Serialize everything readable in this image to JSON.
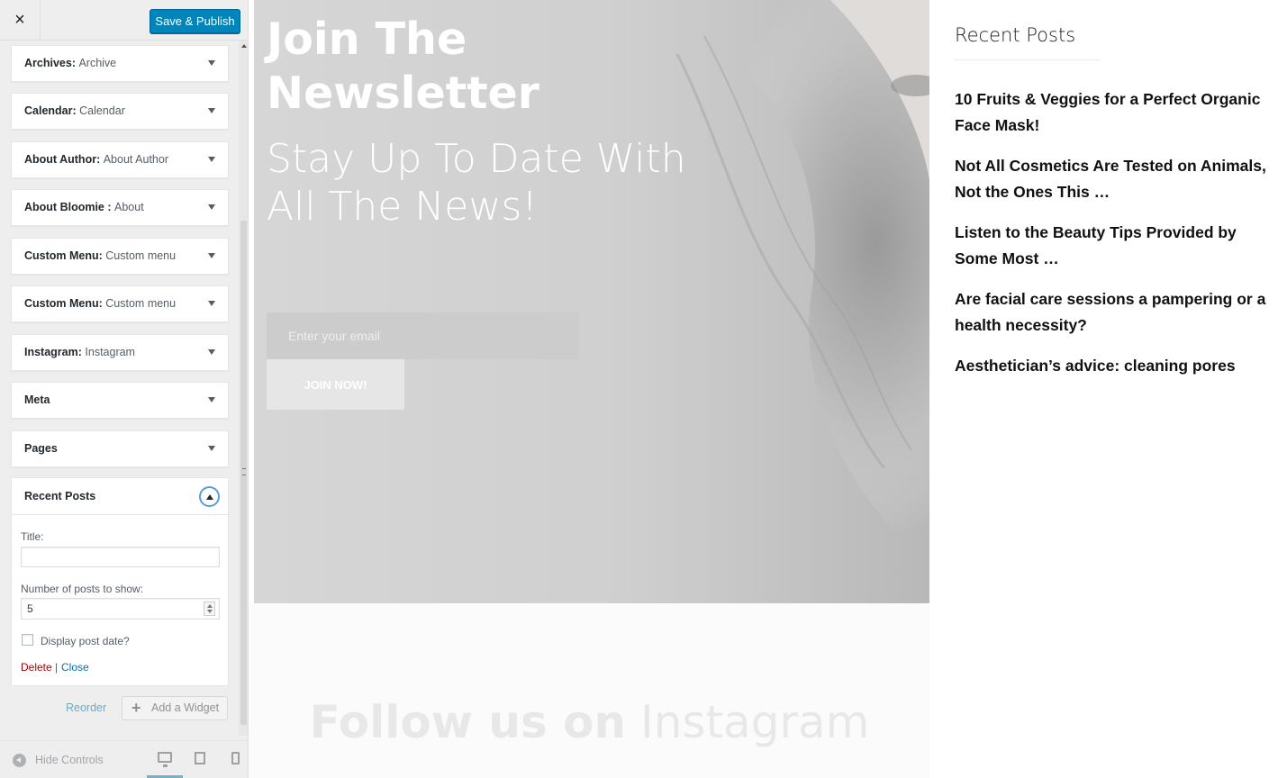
{
  "customizer": {
    "close_icon": "×",
    "publish_label": "Save & Publish",
    "widgets": [
      {
        "type": "Archives",
        "title": "Archive"
      },
      {
        "type": "Calendar",
        "title": "Calendar"
      },
      {
        "type": "About Author",
        "title": "About Author"
      },
      {
        "type": "About Bloomie ",
        "title": "About"
      },
      {
        "type": "Custom Menu",
        "title": "Custom menu"
      },
      {
        "type": "Custom Menu",
        "title": "Custom menu"
      },
      {
        "type": "Instagram",
        "title": "Instagram"
      },
      {
        "type": "Meta",
        "title": ""
      },
      {
        "type": "Pages",
        "title": ""
      }
    ],
    "recent_posts_widget": {
      "header": "Recent Posts",
      "title_label": "Title:",
      "title_value": "",
      "number_label": "Number of posts to show:",
      "number_value": "5",
      "display_date_label": "Display post date?",
      "delete_label": "Delete",
      "separator": "|",
      "close_label": "Close"
    },
    "reorder_label": "Reorder",
    "add_widget_label": "Add a Widget",
    "hide_controls_label": "Hide Controls",
    "accent_color": "#0085ba"
  },
  "preview": {
    "newsletter": {
      "title": "Join The Newsletter",
      "subtitle": "Stay Up To Date With All The News!",
      "email_placeholder": "Enter your email",
      "button_label": "JOIN NOW!"
    },
    "instagram": {
      "follow_bold": "Follow us on",
      "follow_light": "Instagram"
    },
    "recent_posts": {
      "heading": "Recent Posts",
      "items": [
        "10 Fruits & Veggies for a Perfect Organic Face Mask!",
        "Not All Cosmetics Are Tested on Animals, Not the Ones This …",
        "Listen to the Beauty Tips Provided by Some Most …",
        "Are facial care sessions a pampering or a health necessity?",
        "Aesthetician’s advice: cleaning pores"
      ]
    }
  }
}
